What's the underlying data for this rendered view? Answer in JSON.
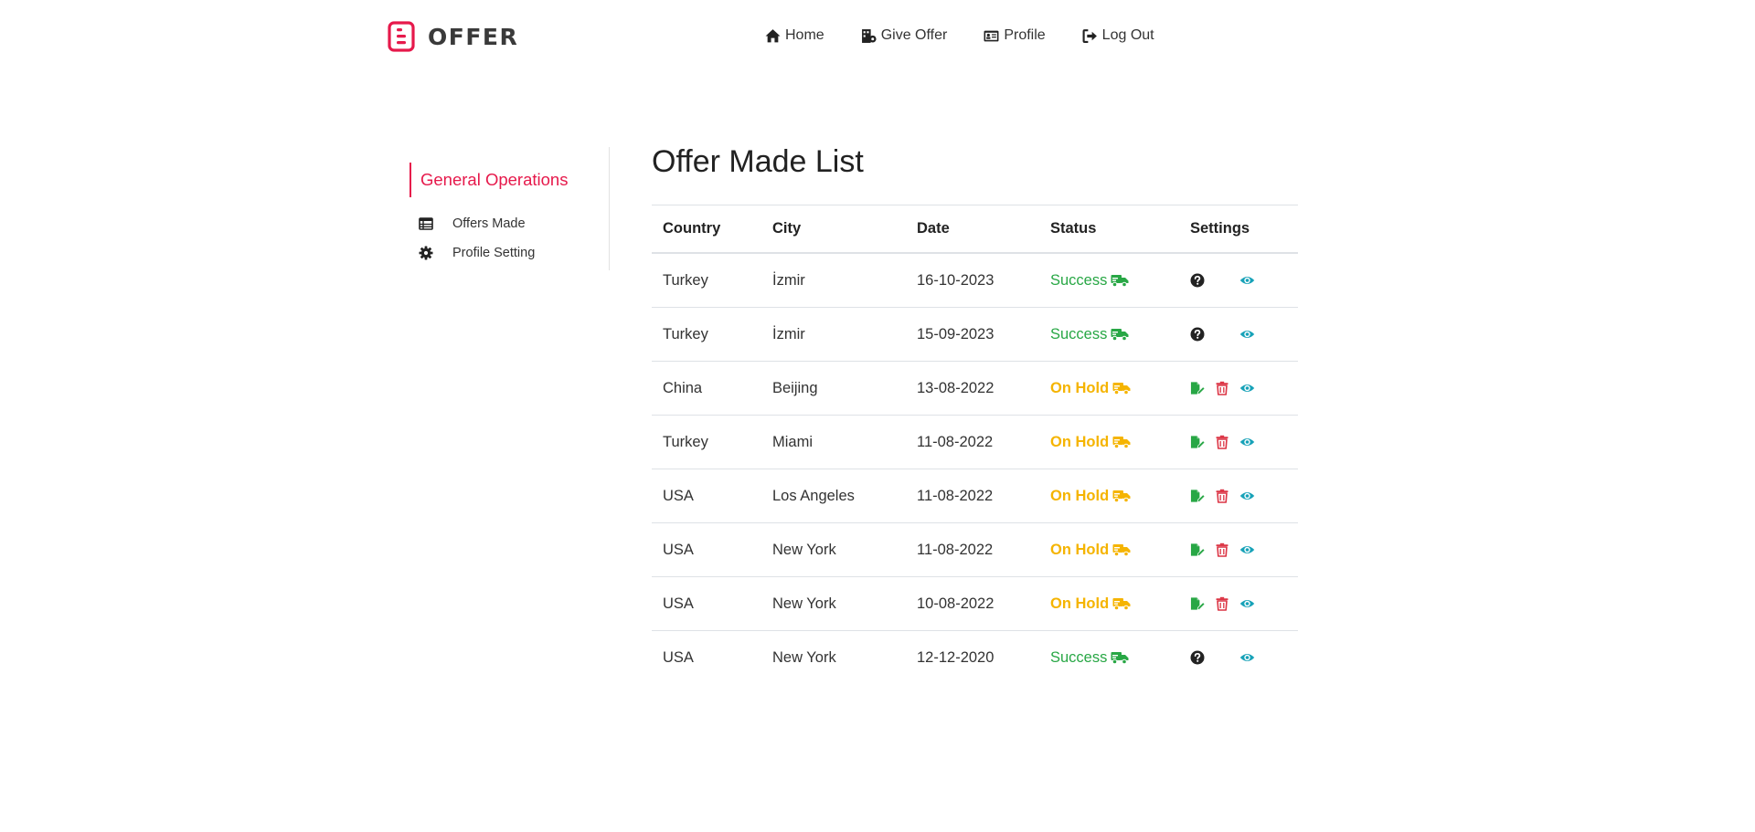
{
  "brand": {
    "name": "OFFER",
    "color": "#e6194b"
  },
  "nav": [
    {
      "label": "Home",
      "icon": "home-icon"
    },
    {
      "label": "Give Offer",
      "icon": "building-icon"
    },
    {
      "label": "Profile",
      "icon": "id-card-icon"
    },
    {
      "label": "Log Out",
      "icon": "sign-out-icon"
    }
  ],
  "sidebar": {
    "title": "General Operations",
    "items": [
      {
        "label": "Offers Made",
        "icon": "table-list-icon"
      },
      {
        "label": "Profile Setting",
        "icon": "gear-icon"
      }
    ]
  },
  "page": {
    "title": "Offer Made List"
  },
  "table": {
    "headers": {
      "country": "Country",
      "city": "City",
      "date": "Date",
      "status": "Status",
      "settings": "Settings"
    },
    "rows": [
      {
        "country": "Turkey",
        "city": "İzmir",
        "date": "16-10-2023",
        "status": "Success",
        "state": "success"
      },
      {
        "country": "Turkey",
        "city": "İzmir",
        "date": "15-09-2023",
        "status": "Success",
        "state": "success"
      },
      {
        "country": "China",
        "city": "Beijing",
        "date": "13-08-2022",
        "status": "On Hold",
        "state": "hold"
      },
      {
        "country": "Turkey",
        "city": "Miami",
        "date": "11-08-2022",
        "status": "On Hold",
        "state": "hold"
      },
      {
        "country": "USA",
        "city": "Los Angeles",
        "date": "11-08-2022",
        "status": "On Hold",
        "state": "hold"
      },
      {
        "country": "USA",
        "city": "New York",
        "date": "11-08-2022",
        "status": "On Hold",
        "state": "hold"
      },
      {
        "country": "USA",
        "city": "New York",
        "date": "10-08-2022",
        "status": "On Hold",
        "state": "hold"
      },
      {
        "country": "USA",
        "city": "New York",
        "date": "12-12-2020",
        "status": "Success",
        "state": "success"
      }
    ]
  },
  "colors": {
    "success": "#28a745",
    "hold": "#f5b400",
    "delete": "#dc3545",
    "view": "#17a2b8",
    "edit": "#28a745",
    "accent": "#e6194b"
  }
}
